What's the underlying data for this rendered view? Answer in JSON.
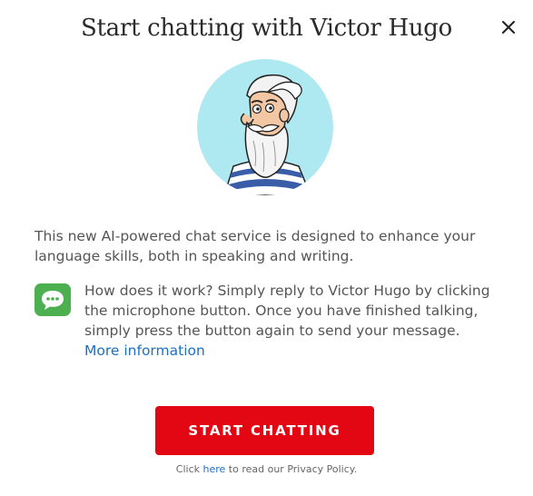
{
  "dialog": {
    "title": "Start chatting with Victor Hugo",
    "close_icon": "close-icon",
    "avatar_icon": "victor-hugo-avatar",
    "intro_text": "This new AI-powered chat service is designed to enhance your language skills, both in speaking and writing.",
    "how_it_works": {
      "icon": "chat-bubble-icon",
      "text": "How does it work? Simply reply to Victor Hugo by clicking the microphone button. Once you have finished talking, simply press the button again to send your message.",
      "link_label": "More information"
    },
    "primary_button_label": "START CHATTING",
    "privacy": {
      "prefix": "Click ",
      "link_label": "here",
      "suffix": " to read our Privacy Policy."
    }
  },
  "colors": {
    "accent_red": "#e30613",
    "link_blue": "#1f6fc4",
    "chat_icon_green": "#4caf50",
    "avatar_bg": "#aee9f2"
  }
}
